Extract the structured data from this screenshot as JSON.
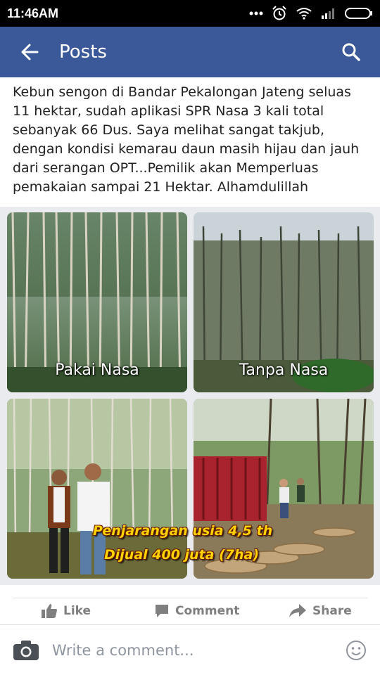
{
  "status_bar": {
    "time": "11:46AM"
  },
  "app_bar": {
    "title": "Posts",
    "back_icon": "arrow-left-icon",
    "search_icon": "search-icon"
  },
  "post": {
    "text": "Kebun sengon di Bandar Pekalongan Jateng seluas 11 hektar, sudah aplikasi SPR Nasa 3 kali total sebanyak 66 Dus. Saya melihat sangat takjub, dengan kondisi kemarau daun masih hijau dan jauh dari serangan OPT...Pemilik akan Memperluas pemakaian sampai 21 Hektar. Alhamdulillah",
    "photos": [
      {
        "caption": "Pakai Nasa"
      },
      {
        "caption": "Tanpa Nasa"
      },
      {
        "caption": ""
      },
      {
        "overlay_line1": "Penjarangan usia 4,5 th",
        "overlay_line2": "Dijual 400 juta (7ha)"
      }
    ]
  },
  "actions": {
    "like": "Like",
    "comment": "Comment",
    "share": "Share"
  },
  "comment_bar": {
    "placeholder": "Write a comment..."
  },
  "colors": {
    "brand": "#3b5998",
    "action_gray": "#7f7f7f"
  }
}
